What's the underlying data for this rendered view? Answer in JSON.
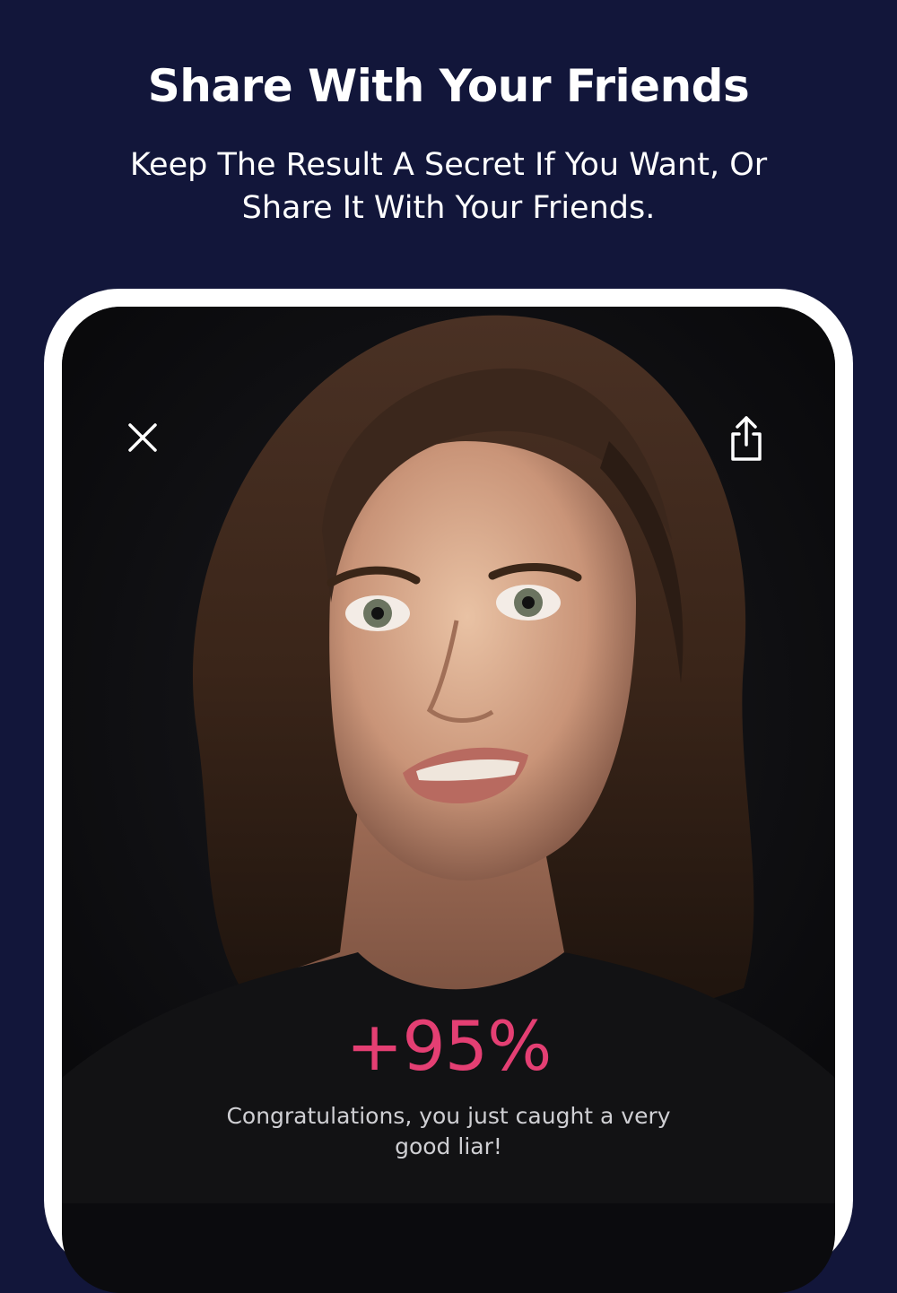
{
  "page": {
    "title": "Share With Your Friends",
    "subtitle": "Keep The Result A Secret If You Want, Or Share It With Your Friends."
  },
  "result_screen": {
    "close_icon": "close-icon",
    "share_icon": "share-icon",
    "photo_description_icon": "face-photo",
    "score": "+95%",
    "message": "Congratulations, you just caught a very good liar!"
  },
  "colors": {
    "background": "#12163a",
    "device_frame": "#ffffff",
    "score_accent": "#e43f73",
    "screen_background": "#0b0b0e"
  }
}
